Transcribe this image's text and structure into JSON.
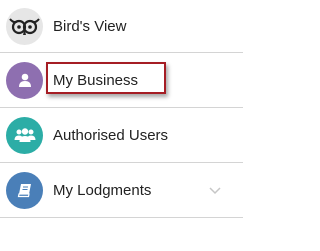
{
  "menu": {
    "items": [
      {
        "label": "Bird's View",
        "icon": "owl-icon",
        "color": "#e6e6e6"
      },
      {
        "label": "My Business",
        "icon": "user-icon",
        "color": "#8e6fb0"
      },
      {
        "label": "Authorised Users",
        "icon": "users-icon",
        "color": "#2cada6"
      },
      {
        "label": "My Lodgments",
        "icon": "book-icon",
        "color": "#4a7fb8",
        "expandable": true
      }
    ]
  },
  "colors": {
    "highlight": "#a51d24",
    "divider": "#d4d4d4"
  }
}
